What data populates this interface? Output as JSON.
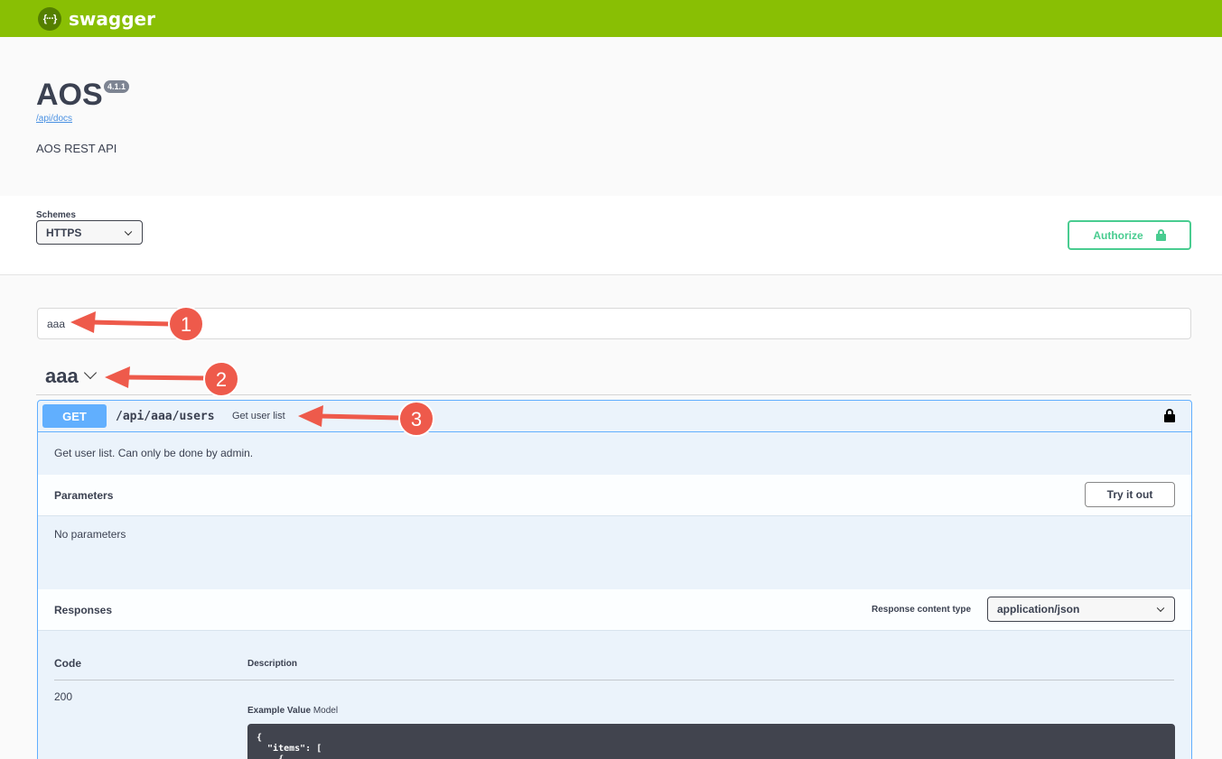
{
  "topbar": {
    "logo_glyph": "{···}",
    "brand": "swagger"
  },
  "info": {
    "title": "AOS",
    "version": "4.1.1",
    "docs_link": "/api/docs",
    "description": "AOS REST API"
  },
  "schemes": {
    "label": "Schemes",
    "selected": "HTTPS"
  },
  "authorize": {
    "label": "Authorize"
  },
  "filter": {
    "value": "aaa"
  },
  "tag": {
    "name": "aaa"
  },
  "operation": {
    "method": "GET",
    "path": "/api/aaa/users",
    "summary": "Get user list",
    "description": "Get user list. Can only be done by admin.",
    "parameters": {
      "title": "Parameters",
      "try_label": "Try it out",
      "empty": "No parameters"
    },
    "responses": {
      "title": "Responses",
      "content_type_label": "Response content type",
      "content_type": "application/json",
      "col_code": "Code",
      "col_description": "Description",
      "rows": [
        {
          "code": "200"
        }
      ],
      "example_tab": "Example Value",
      "model_tab": "Model",
      "example_code": "{\n  \"items\": [\n    {"
    }
  },
  "annotations": [
    "1",
    "2",
    "3"
  ],
  "colors": {
    "brand": "#89bf04",
    "get": "#61affe",
    "authorize": "#49cc90",
    "arrow": "#f05545"
  }
}
